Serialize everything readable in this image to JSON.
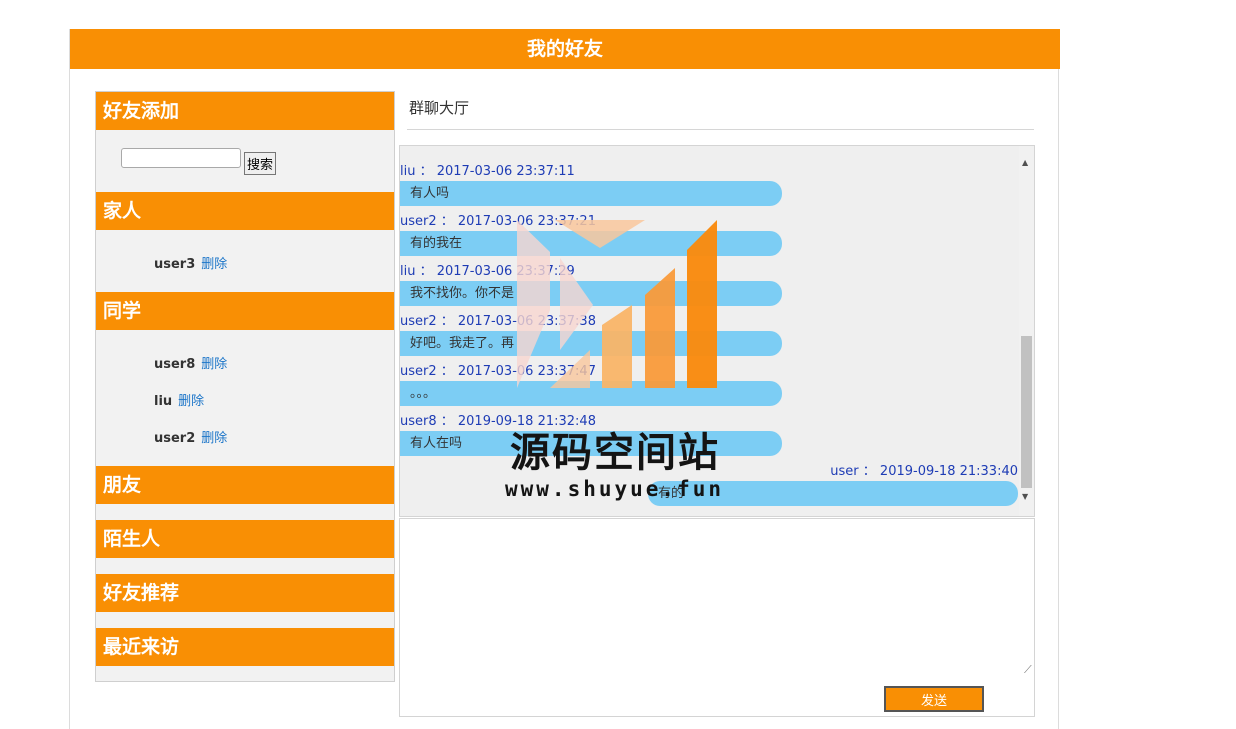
{
  "header": {
    "title": "我的好友"
  },
  "search": {
    "section_title": "好友添加",
    "button_label": "搜索",
    "placeholder": ""
  },
  "groups": [
    {
      "name": "家人",
      "friends": [
        {
          "name": "user3",
          "action": "删除"
        }
      ]
    },
    {
      "name": "同学",
      "friends": [
        {
          "name": "user8",
          "action": "删除"
        },
        {
          "name": "liu",
          "action": "删除"
        },
        {
          "name": "user2",
          "action": "删除"
        }
      ]
    },
    {
      "name": "朋友",
      "friends": []
    },
    {
      "name": "陌生人",
      "friends": []
    },
    {
      "name": "好友推荐",
      "friends": []
    },
    {
      "name": "最近来访",
      "friends": []
    }
  ],
  "chat": {
    "title": "群聊大厅",
    "messages": [
      {
        "meta": "liu ： 2017-03-06 23:37:11",
        "text": "有人吗"
      },
      {
        "meta": "user2 ： 2017-03-06 23:37:21",
        "text": "有的我在"
      },
      {
        "meta": "liu ： 2017-03-06 23:37:29",
        "text": "我不找你。你不是"
      },
      {
        "meta": "user2 ： 2017-03-06 23:37:38",
        "text": "好吧。我走了。再"
      },
      {
        "meta": "user2 ： 2017-03-06 23:37:47",
        "text": "。。。"
      },
      {
        "meta": "user8 ： 2019-09-18 21:32:48",
        "text": "有人在吗"
      },
      {
        "meta": "user ： 2019-09-18 21:33:40",
        "text": "有的"
      }
    ],
    "send_label": "发送",
    "input_value": ""
  },
  "watermark": {
    "text": "源码空间站",
    "url": "www.shuyue.fun"
  },
  "colors": {
    "accent": "#f98f04",
    "bubble": "#7ccdf4",
    "link": "#1a74c8",
    "meta": "#1e3cb5"
  }
}
